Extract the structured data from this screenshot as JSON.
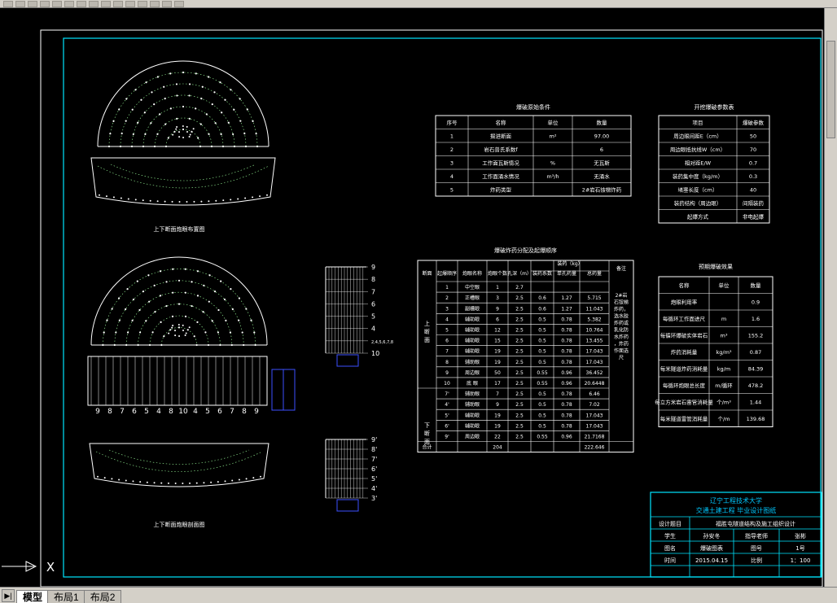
{
  "tabs": {
    "model": "模型",
    "layout1": "布局1",
    "layout2": "布局2"
  },
  "icons": {
    "tab_nav": "tab-nav-arrow-icon",
    "ucs": "ucs-axis-icon"
  },
  "drawing": {
    "upper_section_caption": "上下断面炮眼布置图",
    "lower_section_caption": "上下断面炮眼剖面图",
    "hole_numbers": [
      "9",
      "8",
      "7",
      "6",
      "5",
      "4",
      "8",
      "10",
      "4",
      "5",
      "6",
      "7",
      "8",
      "9"
    ],
    "profile_upper_labels": [
      "9",
      "8",
      "7",
      "6",
      "5",
      "4",
      "2,4,5,6,7,8",
      "10"
    ],
    "profile_lower_labels": [
      "9'",
      "8'",
      "7'",
      "6'",
      "5'",
      "4'",
      "3'"
    ]
  },
  "blasting_conditions": {
    "title": "爆破原始条件",
    "headers": [
      "序号",
      "名称",
      "单位",
      "数量"
    ],
    "rows": [
      [
        "1",
        "掘进断面",
        "m²",
        "97.00"
      ],
      [
        "2",
        "岩石普氏系数f",
        "",
        "6"
      ],
      [
        "3",
        "工作面瓦斯情况",
        "%",
        "无瓦斯"
      ],
      [
        "4",
        "工作面涌水情况",
        "m³/h",
        "无涌水"
      ],
      [
        "5",
        "炸药类型",
        "",
        "2#岩石铵梯炸药"
      ]
    ]
  },
  "excavation_params": {
    "title": "开挖爆破参数表",
    "headers": [
      "项目",
      "爆破参数"
    ],
    "rows": [
      [
        "周边眼间距E（cm）",
        "50"
      ],
      [
        "周边眼抵抗线W（cm）",
        "70"
      ],
      [
        "相对距E/W",
        "0.7"
      ],
      [
        "装药集中度（kg/m）",
        "0.3"
      ],
      [
        "堵塞长度（cm）",
        "40"
      ],
      [
        "装药结构（周边眼）",
        "间隔装药"
      ],
      [
        "起爆方式",
        "非电起爆"
      ]
    ]
  },
  "charge_table": {
    "title": "爆破炸药分配及起爆顺序",
    "headers": [
      "断面",
      "起爆顺序",
      "炮眼名称",
      "炮眼个数",
      "孔深（m）",
      "装药（kg）",
      "装药系数",
      "单孔药量",
      "总药量",
      "备注"
    ],
    "section_upper": "上断面",
    "section_lower": "下断面",
    "remark": "2#岩石铵梯炸药，选水胶炸药或乳化防水炸药，炸药作面选尺",
    "rows": [
      [
        "1",
        "中空眼",
        "1",
        "2.7",
        "",
        "",
        ""
      ],
      [
        "2",
        "正槽眼",
        "3",
        "2.5",
        "0.6",
        "1.27",
        "5.715"
      ],
      [
        "3",
        "副槽眼",
        "9",
        "2.5",
        "0.6",
        "1.27",
        "11.043"
      ],
      [
        "4",
        "辅助眼",
        "6",
        "2.5",
        "0.5",
        "0.78",
        "5.382"
      ],
      [
        "5",
        "辅助眼",
        "12",
        "2.5",
        "0.5",
        "0.78",
        "10.764"
      ],
      [
        "6",
        "辅助眼",
        "15",
        "2.5",
        "0.5",
        "0.78",
        "13.455"
      ],
      [
        "7",
        "辅助眼",
        "19",
        "2.5",
        "0.5",
        "0.78",
        "17.043"
      ],
      [
        "8",
        "辅助眼",
        "19",
        "2.5",
        "0.5",
        "0.78",
        "17.043"
      ],
      [
        "9",
        "周边眼",
        "50",
        "2.5",
        "0.55",
        "0.96",
        "36.452"
      ],
      [
        "10",
        "底 眼",
        "17",
        "2.5",
        "0.55",
        "0.96",
        "20.6448"
      ],
      [
        "7'",
        "辅助眼",
        "7",
        "2.5",
        "0.5",
        "0.78",
        "6.46"
      ],
      [
        "4'",
        "辅助眼",
        "9",
        "2.5",
        "0.5",
        "0.78",
        "7.02"
      ],
      [
        "5'",
        "辅助眼",
        "19",
        "2.5",
        "0.5",
        "0.78",
        "17.043"
      ],
      [
        "6'",
        "辅助眼",
        "19",
        "2.5",
        "0.5",
        "0.78",
        "17.043"
      ],
      [
        "9'",
        "周边眼",
        "22",
        "2.5",
        "0.55",
        "0.96",
        "21.7168"
      ]
    ],
    "total_label": "合计",
    "total_count": "204",
    "total_charge": "222.646"
  },
  "expected_effect": {
    "title": "预期爆破效果",
    "headers": [
      "名称",
      "单位",
      "数量"
    ],
    "rows": [
      [
        "炮眼利用率",
        "",
        "0.9"
      ],
      [
        "每循环工作面进尺",
        "m",
        "1.6"
      ],
      [
        "每循环爆破实体岩石",
        "m³",
        "155.2"
      ],
      [
        "炸药消耗量",
        "kg/m³",
        "0.87"
      ],
      [
        "每米隧道炸药消耗量",
        "kg/m",
        "84.39"
      ],
      [
        "每循环炮眼总长度",
        "m/循环",
        "478.2"
      ],
      [
        "每立方米岩石雷管消耗量",
        "个/m³",
        "1.44"
      ],
      [
        "每米隧道雷管消耗量",
        "个/m",
        "139.68"
      ]
    ]
  },
  "title_block": {
    "school": "辽宁工程技术大学",
    "title": "交通土建工程 毕业设计图纸",
    "design_topic_label": "设计题目",
    "design_topic": "福胜屯隧道结构及施工组织设计",
    "student_label": "学生",
    "student": "孙安冬",
    "advisor_label": "指导老师",
    "advisor": "张彬",
    "drawing_name_label": "图名",
    "drawing_name": "爆破图表",
    "drawing_no_label": "图号",
    "drawing_no": "1号",
    "date_label": "时间",
    "date": "2015.04.15",
    "scale_label": "比例",
    "scale": "1：100"
  },
  "colors": {
    "frame": "#00e5ff",
    "lines": "#ffffff",
    "holes": "#9bff9b",
    "blue": "#3b4fff",
    "green": "#00ff00",
    "accent": "#00c8ff"
  }
}
